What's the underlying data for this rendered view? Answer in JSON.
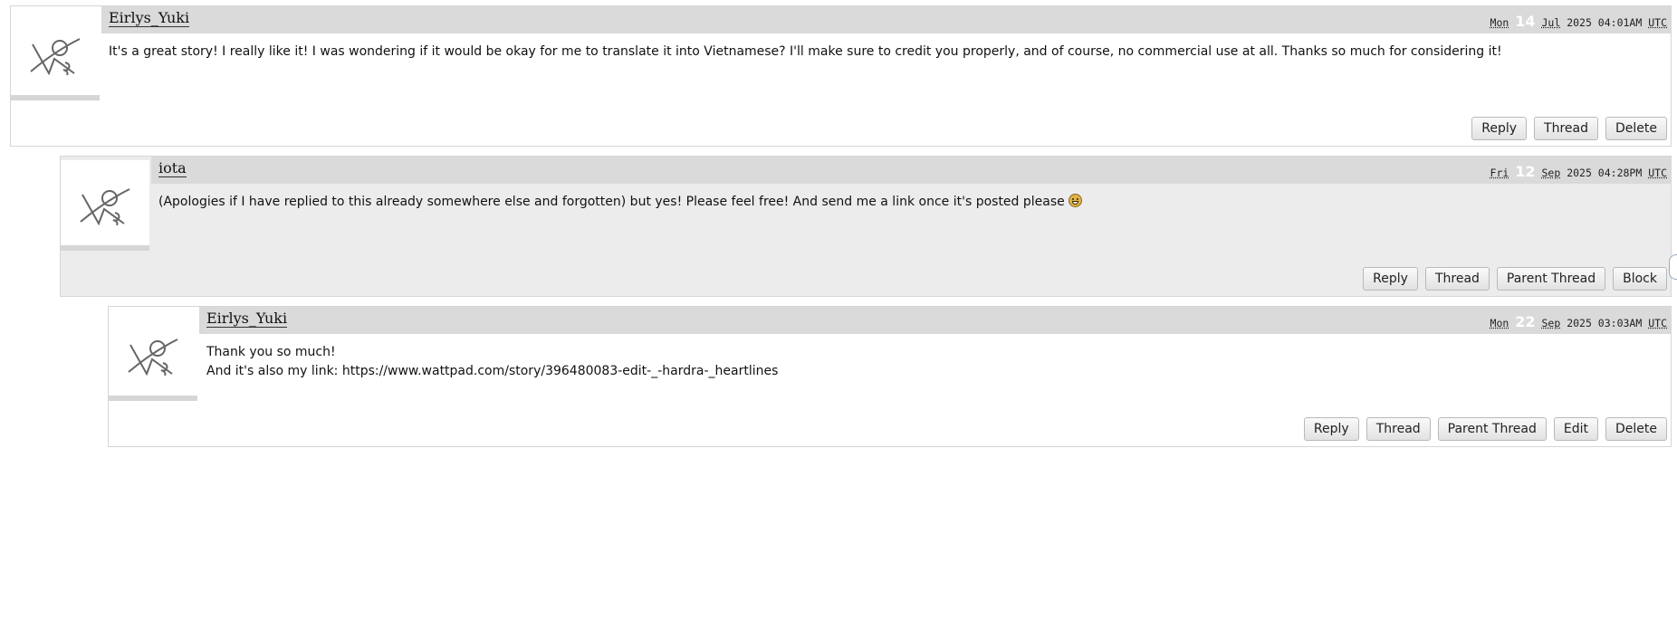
{
  "comments": [
    {
      "username": "Eirlys_Yuki",
      "date": {
        "weekday": "Mon",
        "day": "14",
        "month": "Jul",
        "rest": "2025 04:01AM",
        "tz": "UTC"
      },
      "text": "It's a great story! I really like it! I was wondering if it would be okay for me to translate it into Vietnamese? I'll make sure to credit you properly, and of course, no commercial use at all. Thanks so much for considering it!",
      "actions": [
        "Reply",
        "Thread",
        "Delete"
      ]
    },
    {
      "username": "iota",
      "date": {
        "weekday": "Fri",
        "day": "12",
        "month": "Sep",
        "rest": "2025 04:28PM",
        "tz": "UTC"
      },
      "text": "(Apologies if I have replied to this already somewhere else and forgotten) but yes! Please feel free! And send me a link once it's posted please",
      "emoji": "grinning-face-icon",
      "actions": [
        "Reply",
        "Thread",
        "Parent Thread",
        "Block"
      ]
    },
    {
      "username": "Eirlys_Yuki",
      "date": {
        "weekday": "Mon",
        "day": "22",
        "month": "Sep",
        "rest": "2025 03:03AM",
        "tz": "UTC"
      },
      "text_line1": "Thank you so much!",
      "text_line2": "And it's also my link: https://www.wattpad.com/story/396480083-edit-_-hardra-_heartlines",
      "actions": [
        "Reply",
        "Thread",
        "Parent Thread",
        "Edit",
        "Delete"
      ]
    }
  ],
  "avatar_icon": "default-avatar-icon",
  "colors": {
    "byline": "#dadada",
    "shaded_bg": "#ececec",
    "border": "#d6d6d6"
  }
}
